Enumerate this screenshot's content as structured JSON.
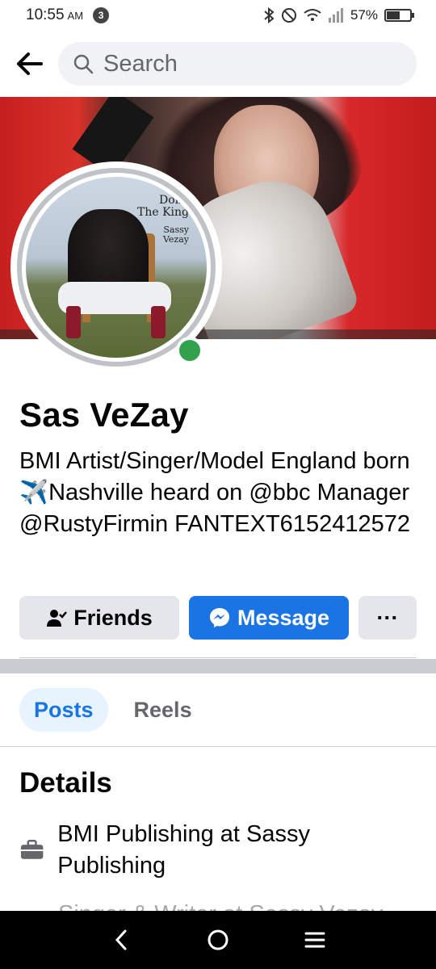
{
  "status_bar": {
    "time": "10:55",
    "ampm": "AM",
    "notification_count": "3",
    "battery_percent": "57%",
    "battery_level": 0.57
  },
  "search": {
    "placeholder": "Search"
  },
  "profile": {
    "avatar_text_line1": "Done\nThe King",
    "avatar_text_line2": "Sassy\nVezay",
    "name": "Sas VeZay",
    "bio": "BMI Artist/Singer/Model England born✈️Nashville heard on @bbc Manager @RustyFirmin FANTEXT6152412572",
    "online": true
  },
  "actions": {
    "friends_label": "Friends",
    "message_label": "Message",
    "more_label": "···"
  },
  "tabs": [
    {
      "label": "Posts",
      "active": true
    },
    {
      "label": "Reels",
      "active": false
    }
  ],
  "details": {
    "title": "Details",
    "work": "BMI Publishing at Sassy Publishing",
    "next_line_partial": "Singer & Writer at Sassy Vezay"
  },
  "colors": {
    "accent": "#1b74e4",
    "online": "#31a24c",
    "tab_active_bg": "#e7f3ff"
  },
  "icons": {
    "back": "arrow-left-icon",
    "search": "search-icon",
    "friends": "person-check-icon",
    "message": "messenger-icon",
    "work": "briefcase-icon"
  }
}
